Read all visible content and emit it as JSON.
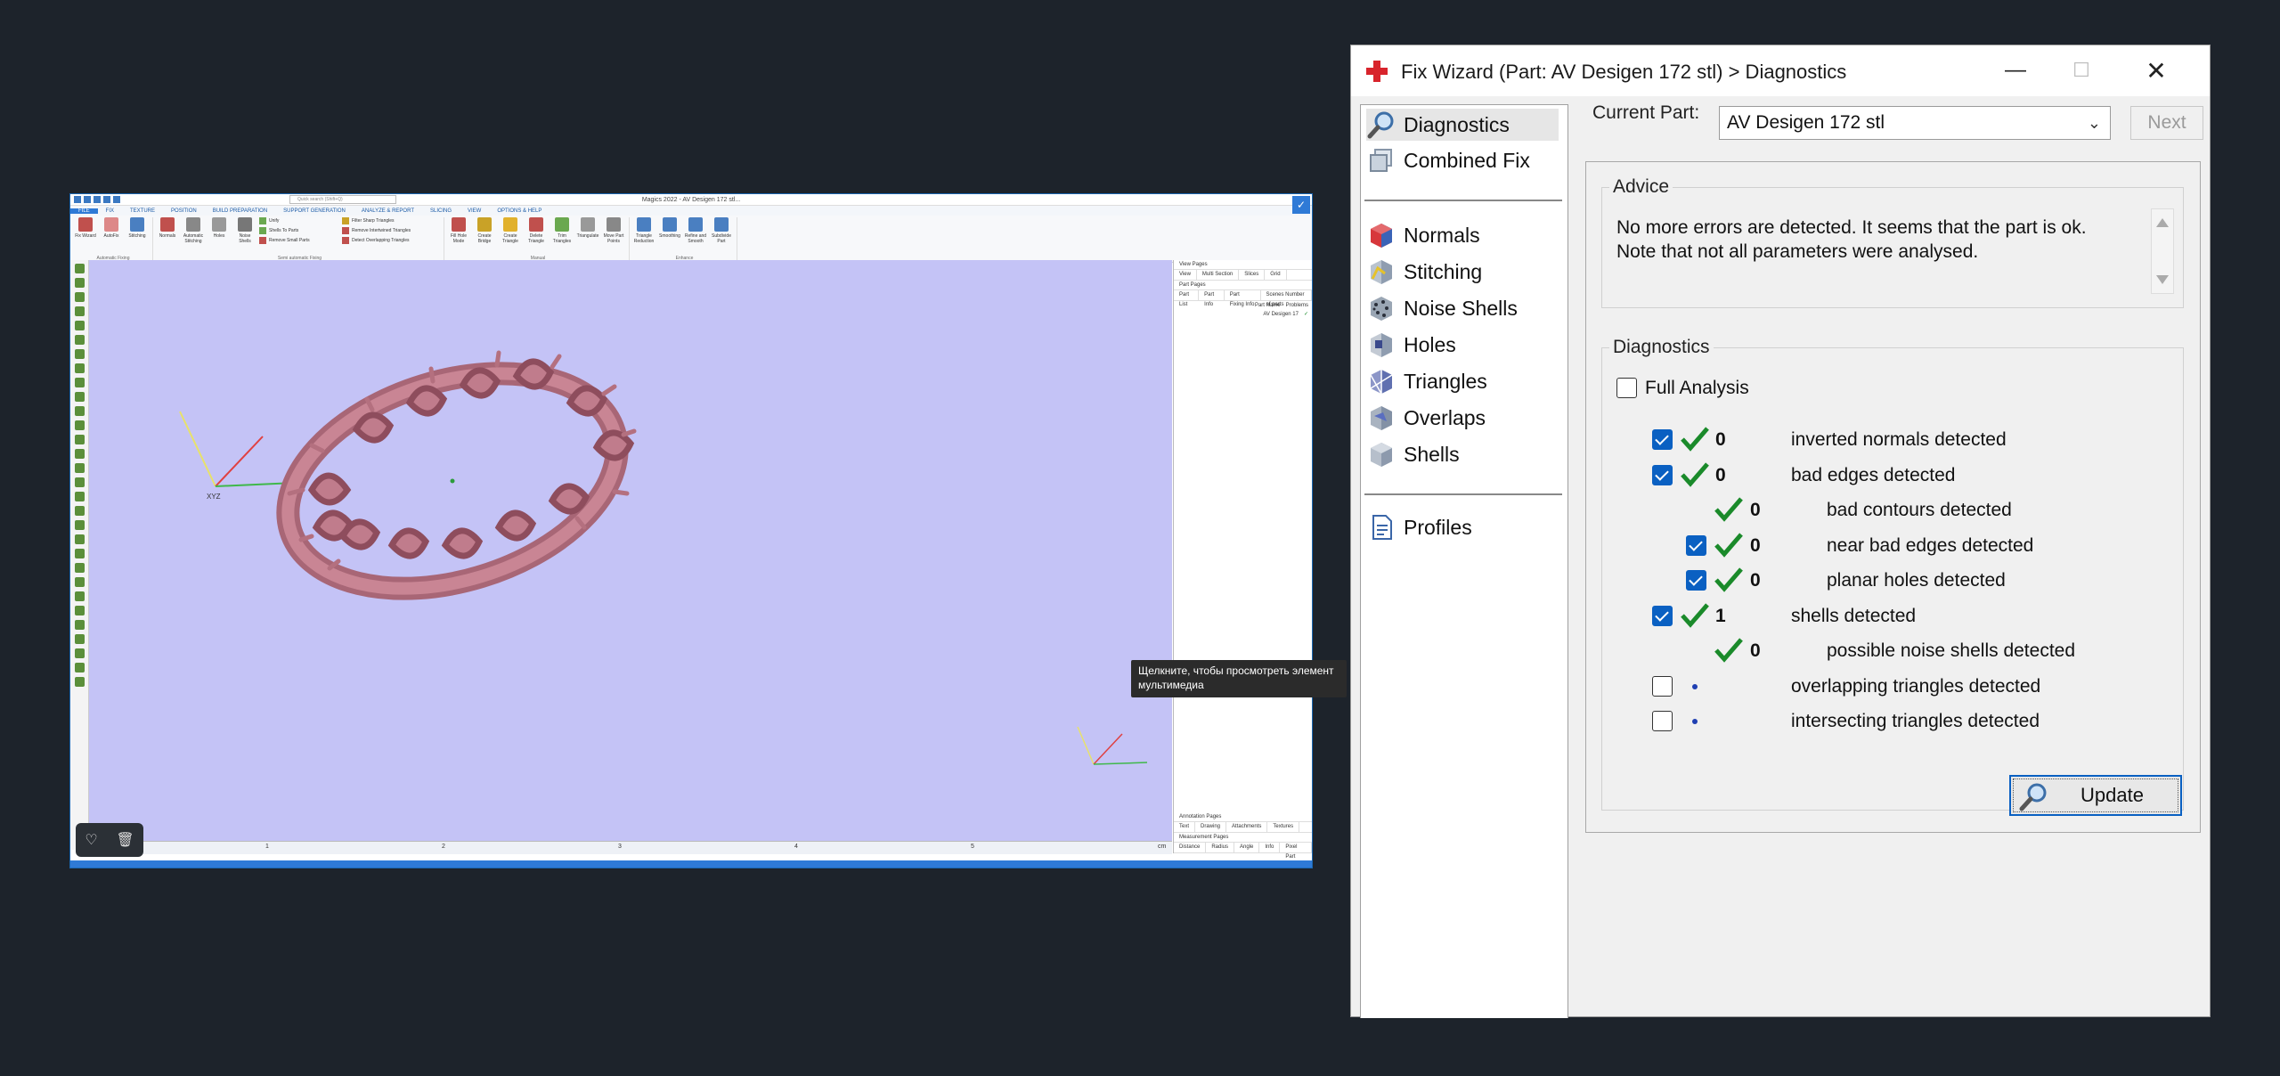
{
  "magics": {
    "title": "Magics 2022 - AV Desigen 172 stl...",
    "search_placeholder": "Quick search (Shift+Q)",
    "menu": [
      "FILE",
      "FIX",
      "TEXTURE",
      "POSITION",
      "BUILD PREPARATION",
      "SUPPORT GENERATION",
      "ANALYZE & REPORT",
      "SLICING",
      "VIEW",
      "OPTIONS & HELP"
    ],
    "ribbon_buttons": [
      "Fix Wizard",
      "AutoFix",
      "Stitching",
      "Normals",
      "Automatic Stitching",
      "Holes",
      "Noise Shells",
      "Fill Hole Mode",
      "Create Bridge",
      "Create Triangle",
      "Delete Triangle",
      "Trim Triangles",
      "Triangulate",
      "Move Part Points",
      "Triangle Reduction",
      "Smoothing",
      "Refine and Smooth",
      "Subdivide Part"
    ],
    "ribbon_list": [
      "Unify",
      "Shells To Parts",
      "Remove Small Parts",
      "Filter Sharp Triangles",
      "Remove Intertwined Triangles",
      "Detect Overlapping Triangles"
    ],
    "ribbon_groups": [
      "Automatic Fixing",
      "Semi automatic Fixing",
      "Manual",
      "Enhance"
    ],
    "ruler_ticks": [
      "1",
      "2",
      "3",
      "4",
      "5"
    ],
    "ruler_unit": "cm",
    "right_sections": [
      "View Pages",
      "Part Pages",
      "Annotation Pages",
      "Measurement Pages"
    ],
    "view_tabs": [
      "View",
      "Multi Section",
      "Slices",
      "Grid"
    ],
    "part_tabs": [
      "Part List",
      "Part Info",
      "Part Fixing Info",
      "Scenes Number of parts"
    ],
    "part_columns": [
      "Part Name",
      "Problems"
    ],
    "part_row_name": "AV Desigen 17",
    "annotation_tabs": [
      "Text",
      "Drawing",
      "Attachments",
      "Textures"
    ],
    "measure_tabs": [
      "Distance",
      "Radius",
      "Angle",
      "Info",
      "Pixel Part"
    ],
    "axis_label": "XYZ"
  },
  "tooltip": "Щелкните, чтобы просмотреть элемент мультимедиа",
  "wizard": {
    "title": "Fix Wizard (Part: AV Desigen 172 stl) > Diagnostics",
    "nav": [
      {
        "label": "Diagnostics",
        "icon": "magnifier-icon"
      },
      {
        "label": "Combined Fix",
        "icon": "combined-fix-icon"
      },
      {
        "label": "Normals",
        "icon": "normals-icon"
      },
      {
        "label": "Stitching",
        "icon": "stitching-icon"
      },
      {
        "label": "Noise Shells",
        "icon": "noise-shells-icon"
      },
      {
        "label": "Holes",
        "icon": "holes-icon"
      },
      {
        "label": "Triangles",
        "icon": "triangles-icon"
      },
      {
        "label": "Overlaps",
        "icon": "overlaps-icon"
      },
      {
        "label": "Shells",
        "icon": "shells-icon"
      },
      {
        "label": "Profiles",
        "icon": "profiles-icon"
      }
    ],
    "current_part_label": "Current Part:",
    "current_part_value": "AV Desigen 172 stl",
    "next_label": "Next",
    "advice_title": "Advice",
    "advice_text_1": "No more errors are detected. It seems that the part is ok.",
    "advice_text_2": "Note that not all parameters were analysed.",
    "diagnostics_title": "Diagnostics",
    "full_analysis_label": "Full Analysis",
    "rows": [
      {
        "checkbox": "checked",
        "status": "ok",
        "count": "0",
        "label": "inverted normals detected"
      },
      {
        "checkbox": "checked",
        "status": "ok",
        "count": "0",
        "label": "bad edges detected"
      },
      {
        "checkbox": "none",
        "status": "ok",
        "count": "0",
        "label": "bad contours detected"
      },
      {
        "checkbox": "checked",
        "status": "ok",
        "count": "0",
        "label": "near bad edges detected"
      },
      {
        "checkbox": "checked",
        "status": "ok",
        "count": "0",
        "label": "planar holes detected"
      },
      {
        "checkbox": "checked",
        "status": "ok",
        "count": "1",
        "label": "shells detected"
      },
      {
        "checkbox": "none",
        "status": "ok",
        "count": "0",
        "label": "possible noise shells detected"
      },
      {
        "checkbox": "unchecked",
        "status": "not-run",
        "count": "",
        "label": "overlapping triangles detected"
      },
      {
        "checkbox": "unchecked",
        "status": "not-run",
        "count": "",
        "label": "intersecting triangles detected"
      }
    ],
    "update_label": "Update",
    "colors": {
      "accent": "#0a60c2",
      "check_green": "#1a8a2a",
      "ring_color": "#bf7b8a",
      "viewport": "#c4c3f6"
    }
  }
}
